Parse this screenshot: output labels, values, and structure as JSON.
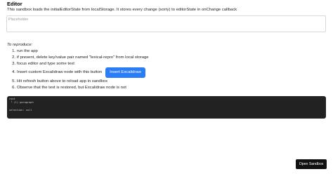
{
  "app": {
    "title": "Editor",
    "description": "This sandbox loads the initialEditorState from localStorage. It stores every change (sorry) to editorState in onChange callback"
  },
  "editor": {
    "placeholder": "Placeholder"
  },
  "repro": {
    "heading": "To reproduce:",
    "steps": [
      {
        "num": "1.",
        "text": "run the app"
      },
      {
        "num": "2.",
        "text": "if present, delete key/value pair named \"lexical-repro\" from local storage"
      },
      {
        "num": "3.",
        "text": "focus editor and type some text"
      },
      {
        "num": "4.",
        "text": "Insert custom Excalidraw node with this button"
      },
      {
        "num": "5.",
        "text": "Hit refresh button above to reload app in sandbox"
      },
      {
        "num": "6.",
        "text": "Observe that the text is restored, but Excalidraw node is not"
      }
    ],
    "insert_button_label": "Insert Excalidraw"
  },
  "tree_view": {
    "lines": [
      "root",
      " └ (1) paragraph",
      "",
      "selection: null"
    ]
  },
  "footer": {
    "open_sandbox_label": "Open Sandbox"
  },
  "colors": {
    "accent_button": "#2a7df5",
    "tree_view_bg": "#222222",
    "open_sandbox_bg": "#111111"
  }
}
